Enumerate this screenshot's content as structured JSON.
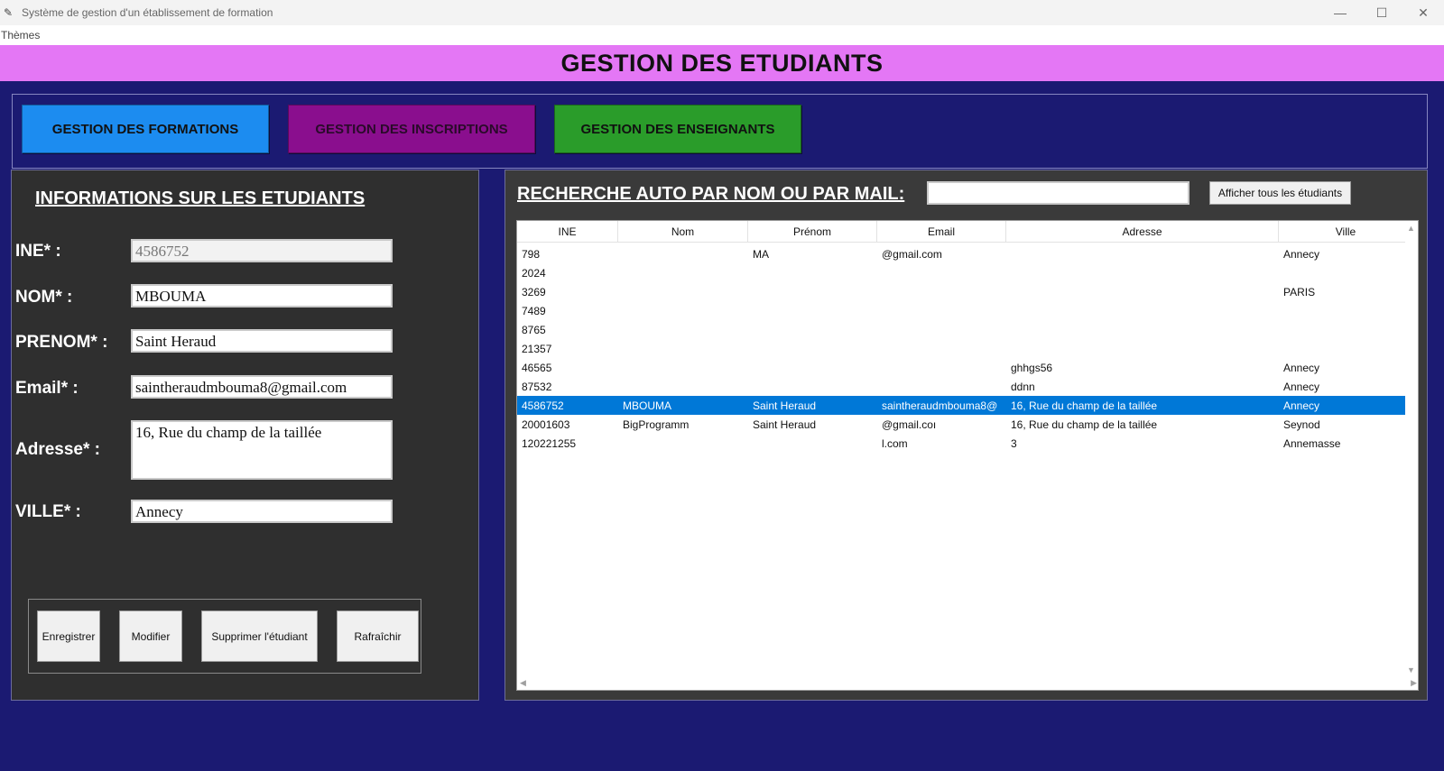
{
  "window": {
    "title": "Système de gestion d'un établissement de formation",
    "controls": {
      "minimize": "—",
      "maximize": "☐",
      "close": "✕"
    }
  },
  "menu": {
    "items": [
      "Thèmes"
    ]
  },
  "banner": {
    "title": "GESTION DES ETUDIANTS",
    "color": "#e477f5"
  },
  "nav": {
    "formations": "GESTION DES FORMATIONS",
    "inscriptions": "GESTION DES INSCRIPTIONS",
    "enseignants": "GESTION DES ENSEIGNANTS",
    "colors": {
      "formations": "#1c8cf0",
      "inscriptions": "#8a0e8e",
      "enseignants": "#2a9c2a"
    }
  },
  "form": {
    "heading": "INFORMATIONS SUR LES ETUDIANTS",
    "fields": {
      "ine": {
        "label": "INE* :",
        "value": "4586752"
      },
      "nom": {
        "label": "NOM* :",
        "value": "MBOUMA"
      },
      "prenom": {
        "label": "PRENOM* :",
        "value": "Saint Heraud"
      },
      "email": {
        "label": "Email* :",
        "value": "saintheraudmbouma8@gmail.com"
      },
      "adresse": {
        "label": "Adresse* :",
        "value": "16, Rue du champ de la taillée"
      },
      "ville": {
        "label": "VILLE* :",
        "value": "Annecy"
      }
    },
    "buttons": {
      "enregistrer": "Enregistrer",
      "modifier": "Modifier",
      "supprimer": "Supprimer l'étudiant",
      "rafraichir": "Rafraîchir"
    }
  },
  "search": {
    "label": "RECHERCHE AUTO PAR NOM OU PAR MAIL:",
    "value": "",
    "show_all": "Afficher tous les étudiants"
  },
  "table": {
    "columns": [
      "INE",
      "Nom",
      "Prénom",
      "Email",
      "Adresse",
      "Ville"
    ],
    "rows": [
      [
        "798",
        "",
        "MA",
        "@gmail.com",
        "",
        "Annecy"
      ],
      [
        "2024",
        "",
        "",
        "",
        "",
        ""
      ],
      [
        "3269",
        "",
        "",
        "",
        "",
        "PARIS"
      ],
      [
        "7489",
        "",
        "",
        "",
        "",
        ""
      ],
      [
        "8765",
        "",
        "",
        "",
        "",
        ""
      ],
      [
        "21357",
        "",
        "",
        "",
        "",
        ""
      ],
      [
        "46565",
        "",
        "",
        "",
        "ghhgs56",
        "Annecy"
      ],
      [
        "87532",
        "",
        "",
        "",
        "ddnn",
        "Annecy"
      ],
      [
        "4586752",
        "MBOUMA",
        "Saint Heraud",
        "saintheraudmbouma8@",
        "16, Rue du champ de la taillée",
        "Annecy"
      ],
      [
        "20001603",
        "BigProgramm",
        "Saint Heraud",
        "@gmail.coı",
        "16, Rue du champ de la taillée",
        "Seynod"
      ],
      [
        "120221255",
        "",
        "",
        "l.com",
        "3",
        "Annemasse"
      ]
    ],
    "selected_index": 8,
    "selection_color": "#0078d7"
  }
}
